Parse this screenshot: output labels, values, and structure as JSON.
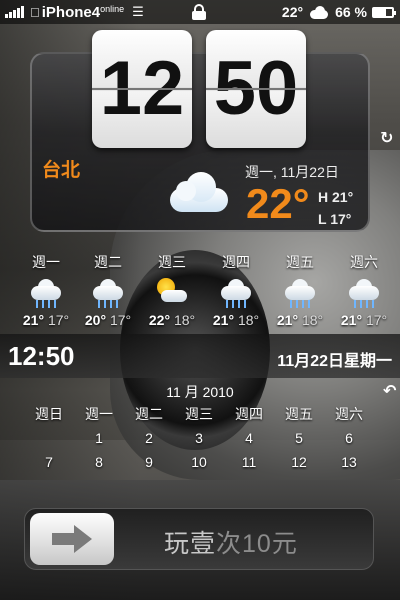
{
  "status_bar": {
    "carrier": "iPhone4",
    "carrier_sup": "online",
    "temperature": "22°",
    "battery_percent": "66 %",
    "battery_level": 0.66,
    "icons": [
      "signal-icon",
      "apple-icon",
      "wifi-icon",
      "lock-icon",
      "cloud-icon",
      "battery-icon"
    ]
  },
  "weather_widget": {
    "hour": "12",
    "minute": "50",
    "city": "台北",
    "date": "週一, 11月22日",
    "temp_now": "22°",
    "high": "H 21°",
    "low": "L 17°",
    "condition_icon": "cloud-icon",
    "accent_color": "#f18a1b"
  },
  "forecast": [
    {
      "day": "週一",
      "high": "21°",
      "low": "17°",
      "icon": "rain-cloud-icon"
    },
    {
      "day": "週二",
      "high": "20°",
      "low": "17°",
      "icon": "rain-cloud-icon"
    },
    {
      "day": "週三",
      "high": "22°",
      "low": "18°",
      "icon": "sun-cloud-icon"
    },
    {
      "day": "週四",
      "high": "21°",
      "low": "18°",
      "icon": "rain-cloud-icon"
    },
    {
      "day": "週五",
      "high": "21°",
      "low": "18°",
      "icon": "rain-cloud-icon"
    },
    {
      "day": "週六",
      "high": "21°",
      "low": "17°",
      "icon": "rain-cloud-icon"
    }
  ],
  "date_bar": {
    "time": "12:50",
    "date": "11月22日星期一"
  },
  "calendar": {
    "title": "11 月 2010",
    "weekdays": [
      "週日",
      "週一",
      "週二",
      "週三",
      "週四",
      "週五",
      "週六"
    ],
    "row1": [
      "",
      "1",
      "2",
      "3",
      "4",
      "5",
      "6"
    ],
    "row2": [
      "7",
      "8",
      "9",
      "10",
      "11",
      "12",
      "13"
    ]
  },
  "unlock": {
    "text_main": "玩壹",
    "text_dim": "次10元",
    "knob_icon": "arrow-right-icon"
  }
}
